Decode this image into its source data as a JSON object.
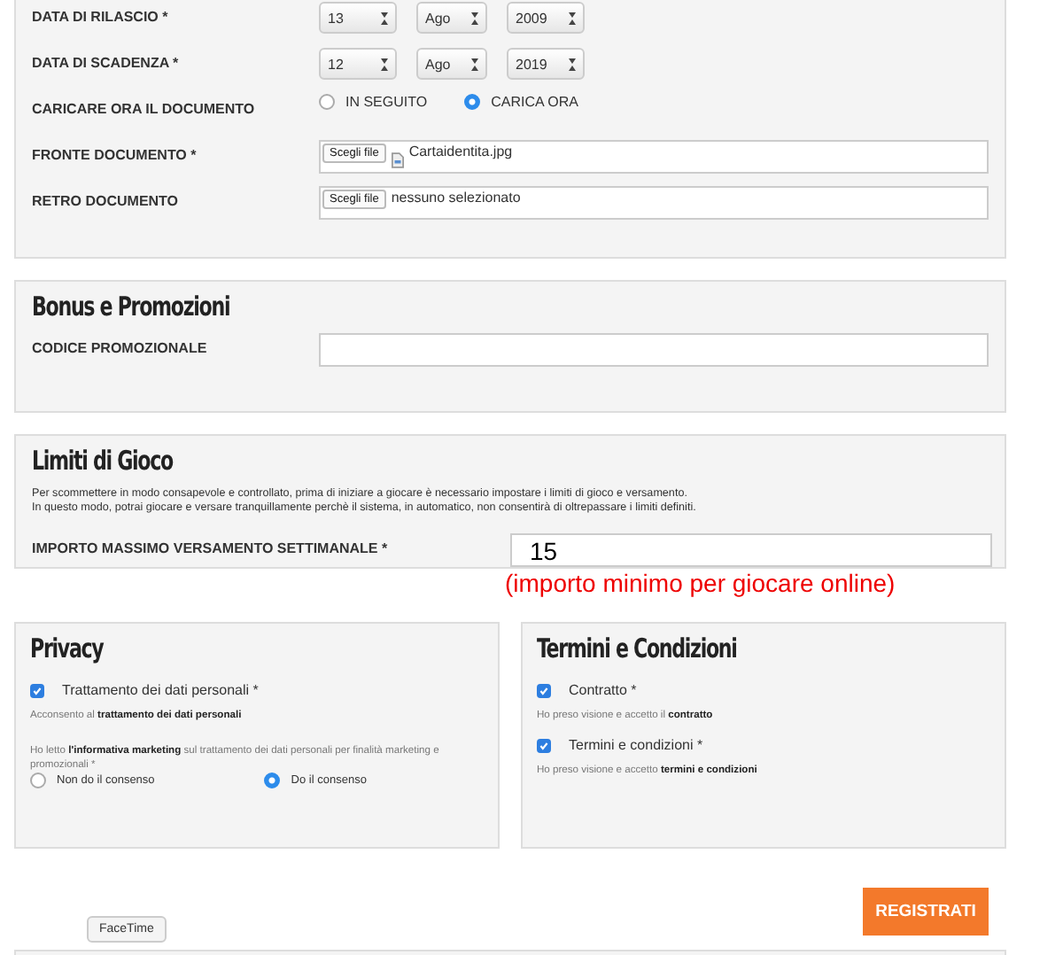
{
  "document_section": {
    "fields": [
      {
        "kind": "date",
        "label": "DATA DI RILASCIO *",
        "day": "13",
        "month": "Ago",
        "year": "2009"
      },
      {
        "kind": "date",
        "label": "DATA DI SCADENZA *",
        "day": "12",
        "month": "Ago",
        "year": "2019"
      },
      {
        "kind": "radio",
        "label": "CARICARE ORA IL DOCUMENTO",
        "options": [
          {
            "label": "IN SEGUITO",
            "selected": false
          },
          {
            "label": "CARICA ORA",
            "selected": true
          }
        ]
      },
      {
        "kind": "file",
        "label": "FRONTE DOCUMENTO *",
        "button": "Scegli file",
        "file_name": "Cartaidentita.jpg",
        "file_icon": true
      },
      {
        "kind": "file",
        "label": "RETRO DOCUMENTO",
        "button": "Scegli file",
        "file_name": "nessuno selezionato",
        "file_icon": false
      }
    ]
  },
  "bonus_section": {
    "title": "Bonus e Promozioni",
    "field": {
      "label": "CODICE PROMOZIONALE"
    }
  },
  "limits_section": {
    "title": "Limiti di Gioco",
    "description": [
      "Per scommettere in modo consapevole e controllato, prima di iniziare a giocare è necessario impostare i limiti di gioco e versamento.",
      "In questo modo, potrai giocare e versare tranquillamente perchè il sistema, in automatico, non consentirà di oltrepassare i limiti definiti."
    ],
    "field": {
      "label": "IMPORTO MASSIMO VERSAMENTO SETTIMANALE *",
      "value": "15",
      "note": "(importo minimo per giocare online)"
    }
  },
  "privacy_section": {
    "title": "Privacy",
    "checkbox": {
      "label": "Trattamento dei dati personali *",
      "checked": true,
      "note": "Acconsento al **trattamento dei dati personali**"
    },
    "marketing_text": "Ho letto **l'informativa marketing** sul trattamento dei dati personali per finalità marketing e promozionali *",
    "options": [
      {
        "label": "Non do il consenso",
        "selected": false
      },
      {
        "label": "Do il consenso",
        "selected": true
      }
    ]
  },
  "terms_section": {
    "title": "Termini e Condizioni",
    "items": [
      {
        "label": "Contratto *",
        "checked": true,
        "note": "Ho preso visione e accetto il **contratto**"
      },
      {
        "label": "Termini e condizioni *",
        "checked": true,
        "note": "Ho preso visione e accetto **termini e condizioni**"
      }
    ]
  },
  "submit_button": "REGISTRATI",
  "tooltip": "FaceTime"
}
